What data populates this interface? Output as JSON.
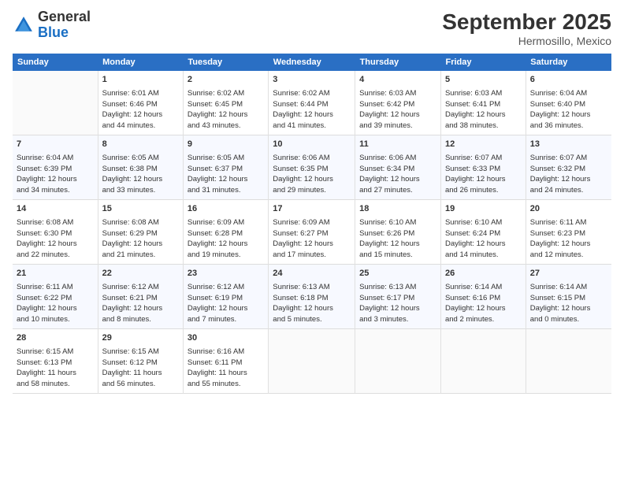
{
  "logo": {
    "general": "General",
    "blue": "Blue"
  },
  "title": "September 2025",
  "location": "Hermosillo, Mexico",
  "days_of_week": [
    "Sunday",
    "Monday",
    "Tuesday",
    "Wednesday",
    "Thursday",
    "Friday",
    "Saturday"
  ],
  "weeks": [
    [
      {
        "day": "",
        "content": ""
      },
      {
        "day": "1",
        "content": "Sunrise: 6:01 AM\nSunset: 6:46 PM\nDaylight: 12 hours\nand 44 minutes."
      },
      {
        "day": "2",
        "content": "Sunrise: 6:02 AM\nSunset: 6:45 PM\nDaylight: 12 hours\nand 43 minutes."
      },
      {
        "day": "3",
        "content": "Sunrise: 6:02 AM\nSunset: 6:44 PM\nDaylight: 12 hours\nand 41 minutes."
      },
      {
        "day": "4",
        "content": "Sunrise: 6:03 AM\nSunset: 6:42 PM\nDaylight: 12 hours\nand 39 minutes."
      },
      {
        "day": "5",
        "content": "Sunrise: 6:03 AM\nSunset: 6:41 PM\nDaylight: 12 hours\nand 38 minutes."
      },
      {
        "day": "6",
        "content": "Sunrise: 6:04 AM\nSunset: 6:40 PM\nDaylight: 12 hours\nand 36 minutes."
      }
    ],
    [
      {
        "day": "7",
        "content": "Sunrise: 6:04 AM\nSunset: 6:39 PM\nDaylight: 12 hours\nand 34 minutes."
      },
      {
        "day": "8",
        "content": "Sunrise: 6:05 AM\nSunset: 6:38 PM\nDaylight: 12 hours\nand 33 minutes."
      },
      {
        "day": "9",
        "content": "Sunrise: 6:05 AM\nSunset: 6:37 PM\nDaylight: 12 hours\nand 31 minutes."
      },
      {
        "day": "10",
        "content": "Sunrise: 6:06 AM\nSunset: 6:35 PM\nDaylight: 12 hours\nand 29 minutes."
      },
      {
        "day": "11",
        "content": "Sunrise: 6:06 AM\nSunset: 6:34 PM\nDaylight: 12 hours\nand 27 minutes."
      },
      {
        "day": "12",
        "content": "Sunrise: 6:07 AM\nSunset: 6:33 PM\nDaylight: 12 hours\nand 26 minutes."
      },
      {
        "day": "13",
        "content": "Sunrise: 6:07 AM\nSunset: 6:32 PM\nDaylight: 12 hours\nand 24 minutes."
      }
    ],
    [
      {
        "day": "14",
        "content": "Sunrise: 6:08 AM\nSunset: 6:30 PM\nDaylight: 12 hours\nand 22 minutes."
      },
      {
        "day": "15",
        "content": "Sunrise: 6:08 AM\nSunset: 6:29 PM\nDaylight: 12 hours\nand 21 minutes."
      },
      {
        "day": "16",
        "content": "Sunrise: 6:09 AM\nSunset: 6:28 PM\nDaylight: 12 hours\nand 19 minutes."
      },
      {
        "day": "17",
        "content": "Sunrise: 6:09 AM\nSunset: 6:27 PM\nDaylight: 12 hours\nand 17 minutes."
      },
      {
        "day": "18",
        "content": "Sunrise: 6:10 AM\nSunset: 6:26 PM\nDaylight: 12 hours\nand 15 minutes."
      },
      {
        "day": "19",
        "content": "Sunrise: 6:10 AM\nSunset: 6:24 PM\nDaylight: 12 hours\nand 14 minutes."
      },
      {
        "day": "20",
        "content": "Sunrise: 6:11 AM\nSunset: 6:23 PM\nDaylight: 12 hours\nand 12 minutes."
      }
    ],
    [
      {
        "day": "21",
        "content": "Sunrise: 6:11 AM\nSunset: 6:22 PM\nDaylight: 12 hours\nand 10 minutes."
      },
      {
        "day": "22",
        "content": "Sunrise: 6:12 AM\nSunset: 6:21 PM\nDaylight: 12 hours\nand 8 minutes."
      },
      {
        "day": "23",
        "content": "Sunrise: 6:12 AM\nSunset: 6:19 PM\nDaylight: 12 hours\nand 7 minutes."
      },
      {
        "day": "24",
        "content": "Sunrise: 6:13 AM\nSunset: 6:18 PM\nDaylight: 12 hours\nand 5 minutes."
      },
      {
        "day": "25",
        "content": "Sunrise: 6:13 AM\nSunset: 6:17 PM\nDaylight: 12 hours\nand 3 minutes."
      },
      {
        "day": "26",
        "content": "Sunrise: 6:14 AM\nSunset: 6:16 PM\nDaylight: 12 hours\nand 2 minutes."
      },
      {
        "day": "27",
        "content": "Sunrise: 6:14 AM\nSunset: 6:15 PM\nDaylight: 12 hours\nand 0 minutes."
      }
    ],
    [
      {
        "day": "28",
        "content": "Sunrise: 6:15 AM\nSunset: 6:13 PM\nDaylight: 11 hours\nand 58 minutes."
      },
      {
        "day": "29",
        "content": "Sunrise: 6:15 AM\nSunset: 6:12 PM\nDaylight: 11 hours\nand 56 minutes."
      },
      {
        "day": "30",
        "content": "Sunrise: 6:16 AM\nSunset: 6:11 PM\nDaylight: 11 hours\nand 55 minutes."
      },
      {
        "day": "",
        "content": ""
      },
      {
        "day": "",
        "content": ""
      },
      {
        "day": "",
        "content": ""
      },
      {
        "day": "",
        "content": ""
      }
    ]
  ]
}
